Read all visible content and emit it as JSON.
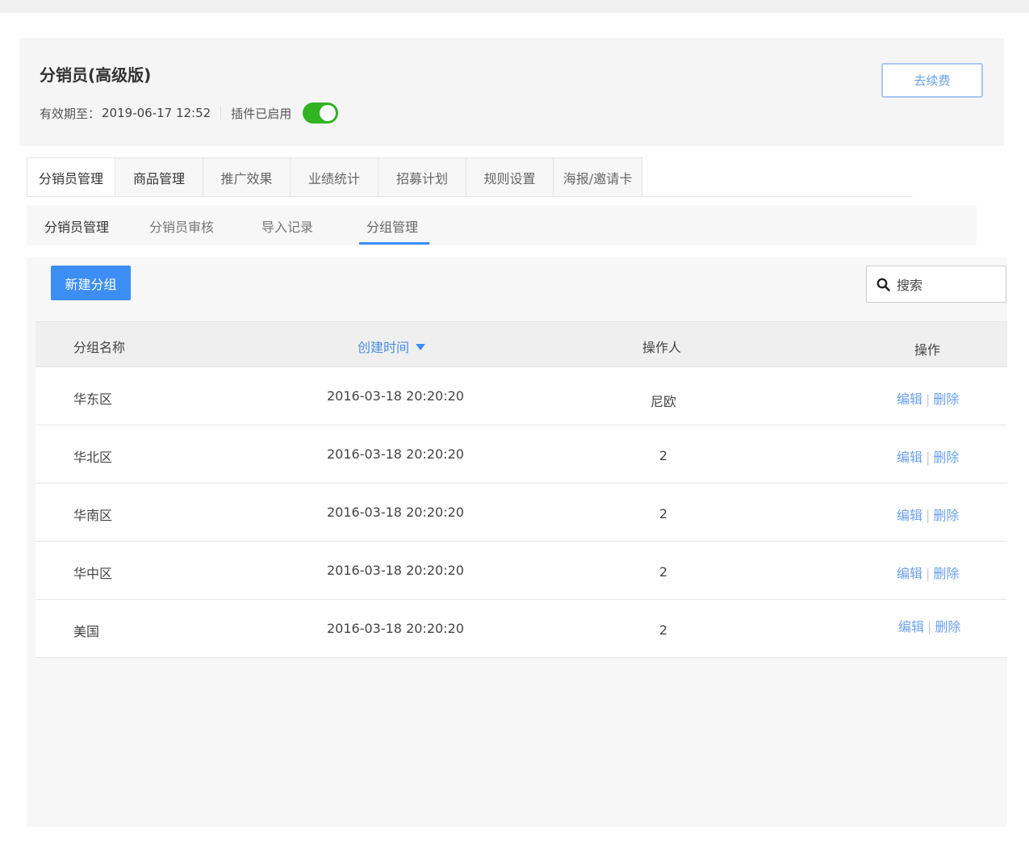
{
  "plugin": {
    "title": "分销员(高级版)",
    "expiry_label": "有效期至：",
    "expiry_date": "2019-06-17 12:52",
    "status_label": "插件已启用",
    "enabled": true,
    "renew_label": "去续费"
  },
  "main_tabs": [
    "分销员管理",
    "商品管理",
    "推广效果",
    "业绩统计",
    "招募计划",
    "规则设置",
    "海报/邀请卡"
  ],
  "sub_tabs": [
    "分销员管理",
    "分销员审核",
    "导入记录",
    "分组管理"
  ],
  "toolbar": {
    "new_group_label": "新建分组",
    "search_label": "搜索"
  },
  "table": {
    "headers": {
      "name": "分组名称",
      "created": "创建时间",
      "operator": "操作人",
      "actions": "操作"
    },
    "rows": [
      {
        "name": "华东区",
        "created": "2016-03-18 20:20:20",
        "operator": "尼欧"
      },
      {
        "name": "华北区",
        "created": "2016-03-18 20:20:20",
        "operator": "2"
      },
      {
        "name": "华南区",
        "created": "2016-03-18 20:20:20",
        "operator": "2"
      },
      {
        "name": "华中区",
        "created": "2016-03-18 20:20:20",
        "operator": "2"
      },
      {
        "name": "美国",
        "created": "2016-03-18 20:20:20",
        "operator": "2"
      }
    ],
    "edit_label": "编辑",
    "delete_label": "删除"
  },
  "colors": {
    "accent": "#3d8ef4",
    "toggle_on": "#31b322",
    "link": "#6ba1ec"
  }
}
